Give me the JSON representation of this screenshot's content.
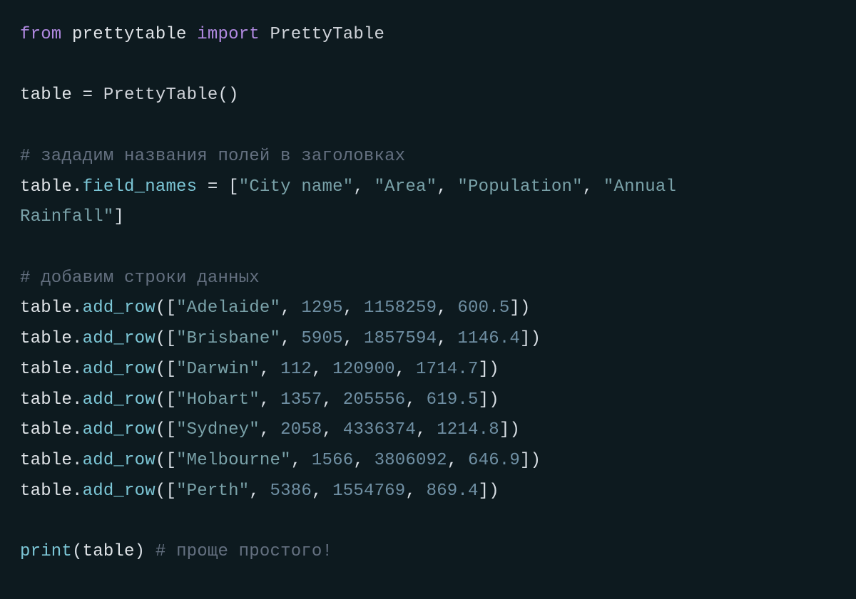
{
  "t": {
    "from": "from",
    "module": "prettytable",
    "import": "import",
    "cls": "PrettyTable",
    "tbl": "table",
    "eq": "=",
    "clsCall": "PrettyTable",
    "lp": "(",
    "rp": ")",
    "comment1": "# зададим названия полей в заголовках",
    "fieldNames": "field_names",
    "lbrk": "[",
    "rbrk": "]",
    "q": "\"",
    "col0": "City name",
    "col1": "Area",
    "col2": "Population",
    "col3_a": "Annual ",
    "col3_b": "Rainfall",
    "comma": ",",
    "comment2": "# добавим строки данных",
    "addRow": "add_row",
    "r0c0": "Adelaide",
    "r0c1": "1295",
    "r0c2": "1158259",
    "r0c3": "600.5",
    "r1c0": "Brisbane",
    "r1c1": "5905",
    "r1c2": "1857594",
    "r1c3": "1146.4",
    "r2c0": "Darwin",
    "r2c1": "112",
    "r2c2": "120900",
    "r2c3": "1714.7",
    "r3c0": "Hobart",
    "r3c1": "1357",
    "r3c2": "205556",
    "r3c3": "619.5",
    "r4c0": "Sydney",
    "r4c1": "2058",
    "r4c2": "4336374",
    "r4c3": "1214.8",
    "r5c0": "Melbourne",
    "r5c1": "1566",
    "r5c2": "3806092",
    "r5c3": "646.9",
    "r6c0": "Perth",
    "r6c1": "5386",
    "r6c2": "1554769",
    "r6c3": "869.4",
    "print": "print",
    "comment3": "# проще простого!",
    "sp": " "
  }
}
